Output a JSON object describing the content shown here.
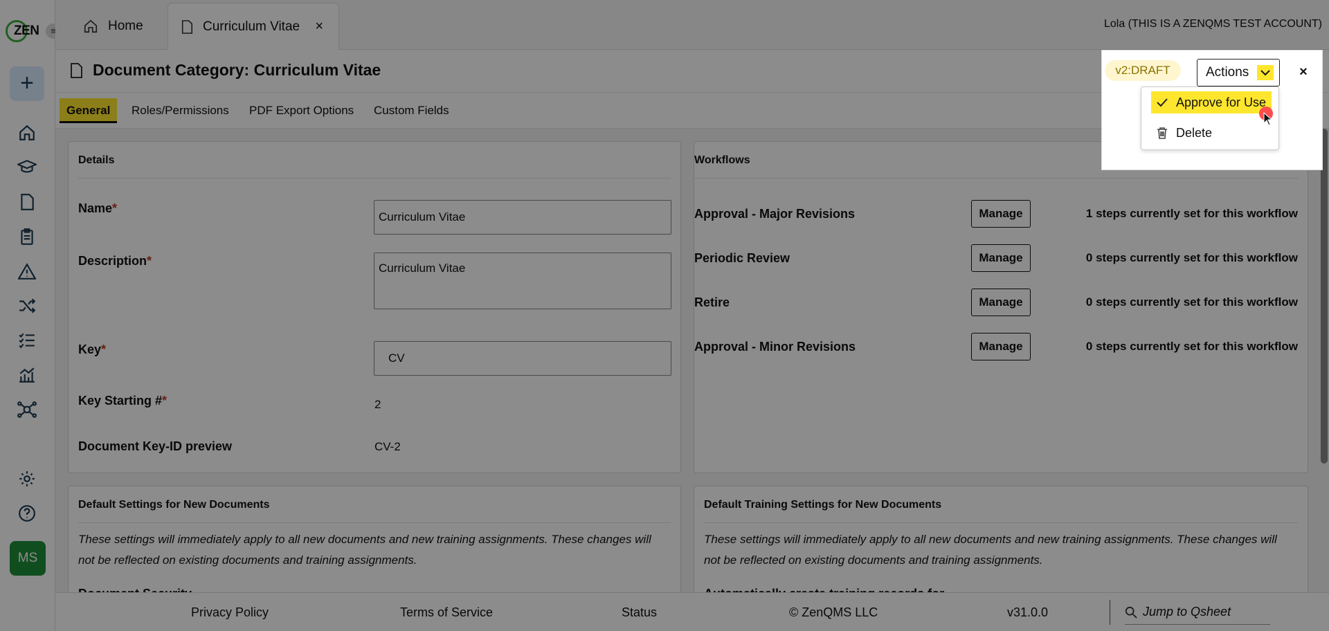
{
  "app": {
    "logo_text": "ZEN",
    "user_label": "Lola (THIS IS A ZENQMS TEST ACCOUNT)",
    "avatar_initials": "MS"
  },
  "tabs": [
    {
      "label": "Home",
      "icon": "home-icon"
    },
    {
      "label": "Curriculum Vitae",
      "icon": "document-icon",
      "close": "×"
    }
  ],
  "page": {
    "title": "Document Category: Curriculum Vitae",
    "version": "v2:DRAFT",
    "actions_label": "Actions"
  },
  "actions_menu": [
    {
      "label": "Approve for Use",
      "icon": "check-icon"
    },
    {
      "label": "Delete",
      "icon": "trash-icon"
    }
  ],
  "subtabs": [
    "General",
    "Roles/Permissions",
    "PDF Export Options",
    "Custom Fields"
  ],
  "details": {
    "title": "Details",
    "name_label": "Name",
    "name_value": "Curriculum Vitae",
    "description_label": "Description",
    "description_value": "Curriculum Vitae",
    "key_label": "Key",
    "key_value": "CV",
    "key_start_label": "Key Starting #",
    "key_start_value": "2",
    "preview_label": "Document Key-ID preview",
    "preview_value": "CV-2",
    "required_mark": "*"
  },
  "workflows": {
    "title": "Workflows",
    "manage_label": "Manage",
    "items": [
      {
        "label": "Approval - Major Revisions",
        "steps": "1 steps currently set for this workflow"
      },
      {
        "label": "Periodic Review",
        "steps": "0 steps currently set for this workflow"
      },
      {
        "label": "Retire",
        "steps": "0 steps currently set for this workflow"
      },
      {
        "label": "Approval - Minor Revisions",
        "steps": "0 steps currently set for this workflow"
      }
    ]
  },
  "default_docs": {
    "title": "Default Settings for New Documents",
    "note": "These settings will immediately apply to all new documents and new training assignments. These changes will not be reflected on existing documents and training assignments.",
    "cut_label": "Document Security"
  },
  "default_training": {
    "title": "Default Training Settings for New Documents",
    "note": "These settings will immediately apply to all new documents and new training assignments. These changes will not be reflected on existing documents and training assignments.",
    "cut_label": "Automatically create training records for"
  },
  "footer": {
    "privacy": "Privacy Policy",
    "terms": "Terms of Service",
    "status": "Status",
    "copyright": "© ZenQMS LLC",
    "version": "v31.0.0",
    "search_placeholder": "Jump to Qsheet"
  },
  "colors": {
    "accent_yellow": "#ffe62e",
    "brand_green": "#3cae3c",
    "avatar_green": "#1f8f3a",
    "required_red": "#c0392b"
  }
}
